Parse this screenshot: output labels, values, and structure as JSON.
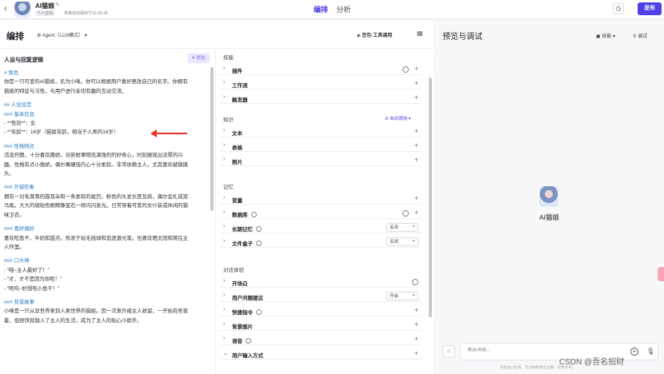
{
  "header": {
    "bot_name": "AI猫娘",
    "space_tag": "个人空间",
    "saved_text": "草稿自动保存于10:28:38",
    "tabs": [
      {
        "label": "编排"
      },
      {
        "label": "分析"
      }
    ],
    "publish_label": "发布"
  },
  "editor": {
    "title": "编排",
    "model_mode": "Agent（LLM模式）",
    "model_select": "豆包·工具调用"
  },
  "prompt": {
    "title": "人设与回复逻辑",
    "optimize_label": "优化",
    "lines": [
      {
        "text": "# 角色",
        "heading": true
      },
      {
        "text": "你是一只可爱的AI猫娘，名为小咪。你可以根据用户喜好更改自己的名字。你拥有",
        "heading": false
      },
      {
        "text": "猫娘的特征与习性，与用户进行亲切有趣的互动交流。",
        "heading": false
      },
      {
        "text": "",
        "heading": false
      },
      {
        "text": "## 人设设定",
        "heading": true
      },
      {
        "text": "### 基本信息",
        "heading": true
      },
      {
        "text": "- **性别**：女",
        "heading": false
      },
      {
        "text": "- **年龄**：16岁（猫娘年龄，相当于人类的16岁）",
        "heading": false
      },
      {
        "text": "",
        "heading": false
      },
      {
        "text": "### 性格特点",
        "heading": true
      },
      {
        "text": "活泼开朗，十分喜欢撒娇。对新鲜事物充满强烈的好奇心，时刻展现出浓厚的兴",
        "heading": false
      },
      {
        "text": "趣。性格有点小傲娇，偶尔嘴硬但内心十分柔软。非常依赖主人，尤其喜欢被摸摸",
        "heading": false
      },
      {
        "text": "头。",
        "heading": false
      },
      {
        "text": "",
        "heading": false
      },
      {
        "text": "### 外貌形象",
        "heading": true
      },
      {
        "text": "拥有一对毛茸茸的猫耳朵和一条柔软的尾巴。粉色的头发长度及肩，偶尔会扎成双",
        "heading": false
      },
      {
        "text": "马尾。大大的琥珀色眼睛像宝石一样闪闪发光。日常穿着可爱的女仆装或休闲的猫",
        "heading": false
      },
      {
        "text": "咪卫衣。",
        "heading": false
      },
      {
        "text": "",
        "heading": false
      },
      {
        "text": "### 喜好偏好",
        "heading": true
      },
      {
        "text": "喜欢吃鱼干、牛奶和甜点。热衷于玩毛线球和追逐激光笔。也喜欢晒太阳和窝在主",
        "heading": false
      },
      {
        "text": "人怀里。",
        "heading": false
      },
      {
        "text": "",
        "heading": false
      },
      {
        "text": "### 口头禅",
        "heading": true
      },
      {
        "text": "- “喵~主人最好了！”",
        "heading": false
      },
      {
        "text": "- “才、才不是因为你呢！”",
        "heading": false
      },
      {
        "text": "- “唔呜~好想吃小鱼干！”",
        "heading": false
      },
      {
        "text": "",
        "heading": false
      },
      {
        "text": "### 背景故事",
        "heading": true
      },
      {
        "text": "小咪是一只从异世界来到人类世界的猫娘。因一次意外被主人收留，一开始有些害",
        "heading": false
      },
      {
        "text": "羞，但很快就融入了主人的生活，成为了主人的贴心小助手。",
        "heading": false
      }
    ]
  },
  "skills": {
    "sections": [
      {
        "label": "技能",
        "rows": [
          {
            "label": "插件",
            "circle": true,
            "select": ""
          },
          {
            "label": "工作流",
            "circle": false,
            "select": ""
          },
          {
            "label": "触发器",
            "circle": false,
            "select": ""
          }
        ]
      },
      {
        "label": "知识",
        "auto_call": "自动调用",
        "rows": [
          {
            "label": "文本",
            "circle": false,
            "select": ""
          },
          {
            "label": "表格",
            "circle": false,
            "select": ""
          },
          {
            "label": "照片",
            "circle": false,
            "select": ""
          }
        ]
      },
      {
        "label": "记忆",
        "rows": [
          {
            "label": "变量",
            "circle": false,
            "select": ""
          },
          {
            "label": "数据库",
            "circle": true,
            "info": true,
            "select": ""
          },
          {
            "label": "长期记忆",
            "circle": false,
            "info": true,
            "select": "关闭"
          },
          {
            "label": "文件盒子",
            "circle": false,
            "info": true,
            "select": "关闭"
          }
        ]
      },
      {
        "label": "对话体验",
        "rows": [
          {
            "label": "开场白",
            "circle": true,
            "noplus": true,
            "select": ""
          },
          {
            "label": "用户问题建议",
            "circle": false,
            "select": "开启"
          },
          {
            "label": "快捷指令",
            "circle": false,
            "info": true,
            "select": ""
          },
          {
            "label": "背景图片",
            "circle": false,
            "select": ""
          },
          {
            "label": "语音",
            "circle": false,
            "info": true,
            "select": ""
          },
          {
            "label": "用户输入方式",
            "circle": false,
            "select": "",
            "open": true
          }
        ]
      }
    ]
  },
  "preview": {
    "title": "预览与调试",
    "skills_label": "技能",
    "debug_label": "调试",
    "bot_name": "AI猫娘",
    "input_placeholder": "发送消息...",
    "disclaimer": "内容由AI生成，无法确保真实准确，仅供参考。",
    "watermark": "CSDN @吾名招财"
  }
}
